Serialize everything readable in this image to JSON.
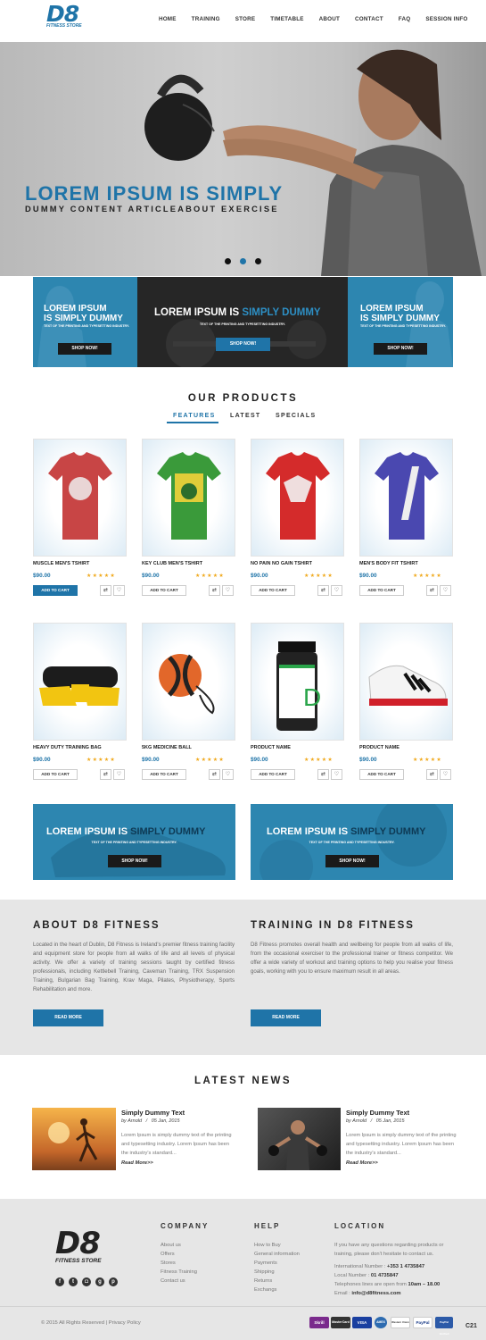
{
  "header": {
    "logo": "D8",
    "logo_sub": "FITNESS STORE",
    "nav": [
      "HOME",
      "TRAINING",
      "STORE",
      "TIMETABLE",
      "ABOUT",
      "CONTACT",
      "FAQ",
      "SESSION INFO"
    ]
  },
  "hero": {
    "heading": "LOREM IPSUM IS SIMPLY",
    "sub": "DUMMY CONTENT ARTICLEABOUT EXERCISE",
    "active_dot": 1
  },
  "promo": {
    "left": {
      "line1": "LOREM IPSUM",
      "line2": "IS SIMPLY DUMMY",
      "small": "TEXT OF THE PRINTING AND TYPESETTING INDUSTRY.",
      "button": "SHOP NOW!"
    },
    "center": {
      "text_a": "LOREM IPSUM IS ",
      "text_b": "SIMPLY DUMMY",
      "small": "TEXT OF THE PRINTING AND TYPESETTING INDUSTRY.",
      "button": "SHOP NOW!"
    },
    "right": {
      "line1": "LOREM IPSUM",
      "line2": "IS SIMPLY DUMMY",
      "small": "TEXT OF THE PRINTING AND TYPESETTING INDUSTRY.",
      "button": "SHOP NOW!"
    }
  },
  "products_section": {
    "title": "OUR PRODUCTS",
    "tabs": [
      "FEATURES",
      "LATEST",
      "SPECIALS"
    ],
    "active_tab": 0
  },
  "products": [
    {
      "name": "MUSCLE MEN'S TSHIRT",
      "price": "$90.00",
      "rating": 5,
      "cart": "ADD TO CART"
    },
    {
      "name": "KEY CLUB MEN'S TSHIRT",
      "price": "$90.00",
      "rating": 5,
      "cart": "ADD TO CART"
    },
    {
      "name": "NO PAIN NO GAIN TSHIRT",
      "price": "$90.00",
      "rating": 5,
      "cart": "ADD TO CART"
    },
    {
      "name": "MEN'S BODY FIT TSHIRT",
      "price": "$90.00",
      "rating": 5,
      "cart": "ADD TO CART"
    },
    {
      "name": "HEAVY DUTY TRAINING BAG",
      "price": "$90.00",
      "rating": 5,
      "cart": "ADD TO CART"
    },
    {
      "name": "5KG MEDICINE BALL",
      "price": "$90.00",
      "rating": 5,
      "cart": "ADD TO CART"
    },
    {
      "name": "PRODUCT NAME",
      "price": "$90.00",
      "rating": 5,
      "cart": "ADD TO CART"
    },
    {
      "name": "PRODUCT NAME",
      "price": "$90.00",
      "rating": 5,
      "cart": "ADD TO CART"
    }
  ],
  "banners": [
    {
      "text_a": "LOREM IPSUM IS ",
      "text_b": "SIMPLY DUMMY",
      "small": "TEXT OF THE PRINTING AND TYPESETTING INDUSTRY.",
      "button": "SHOP NOW!"
    },
    {
      "text_a": "LOREM IPSUM IS ",
      "text_b": "SIMPLY DUMMY",
      "small": "TEXT OF THE PRINTING AND TYPESETTING INDUSTRY.",
      "button": "SHOP NOW!"
    }
  ],
  "about": {
    "title": "ABOUT D8 FITNESS",
    "text": "Located in the heart of Dublin, D8 Fitness is Ireland's premier fitness training facility and equipment store for people from all walks of life and all levels of physical activity. We offer a variety of training sessions taught by certified fitness professionals, including Kettlebell Training, Caveman Training, TRX Suspension Training, Bulgarian Bag Training, Krav Maga, Pilates, Physiotherapy, Sports Rehabilitation and more.",
    "button": "READ MORE"
  },
  "training": {
    "title": "TRAINING IN D8 FITNESS",
    "text": "D8 Fitness promotes overall health and wellbeing for people from all walks of life, from the occasional exerciser to the professional trainer or fitness competitor. We offer a wide variety of workout and training options to help you realise your fitness goals, working with you to ensure maximum result in all areas.",
    "button": "READ MORE"
  },
  "news": {
    "title": "LATEST NEWS",
    "items": [
      {
        "title": "Simply Dummy Text",
        "author": "by Arnold",
        "sep": "/",
        "date": "05 Jan, 2015",
        "text": "Lorem Ipsum is simply dummy text of the printing and typesetting industry. Lorem Ipsum has been the industry's standard...",
        "more": "Read More>>"
      },
      {
        "title": "Simply Dummy Text",
        "author": "by Arnold",
        "sep": "/",
        "date": "05 Jan, 2015",
        "text": "Lorem Ipsum is simply dummy text of the printing and typesetting industry. Lorem Ipsum has been the industry's standard...",
        "more": "Read More>>"
      }
    ]
  },
  "footer": {
    "logo": "D8",
    "logo_sub": "FITNESS STORE",
    "company": {
      "title": "COMPANY",
      "links": [
        "About us",
        "Offers",
        "Stores",
        "Fitness Training",
        "Contact us"
      ]
    },
    "help": {
      "title": "HELP",
      "links": [
        "How to Buy",
        "General information",
        "Payments",
        "Shipping",
        "Returns",
        "Exchangs"
      ]
    },
    "location": {
      "title": "LOCATION",
      "intro": "If you have any questions regarding products or training, please don't hesitate to contact us.",
      "intl_label": "International Number : ",
      "intl": "+353 1 4735847",
      "local_label": "Local Number : ",
      "local": "01 4735847",
      "hours_label": "Telephones lines are open from ",
      "hours": "10am – 18.00",
      "email_label": "Email : ",
      "email": "info@d8fitness.com"
    },
    "social": [
      "facebook-icon",
      "twitter-icon",
      "instagram-icon",
      "googleplus-icon",
      "pinterest-icon"
    ],
    "copyright": "© 2015 All Rights Reserved | Privacy Policy",
    "payments": [
      "Skrill",
      "MasterCard",
      "VISA",
      "AMEX",
      "Western Union",
      "PayPal",
      "PayPal Verified"
    ],
    "corner_label": "C21"
  },
  "colors": {
    "brand_blue": "#1f74a8",
    "promo_blue": "#2d86b0",
    "star": "#f0a81a",
    "footer_bg": "#e6e6e6"
  }
}
